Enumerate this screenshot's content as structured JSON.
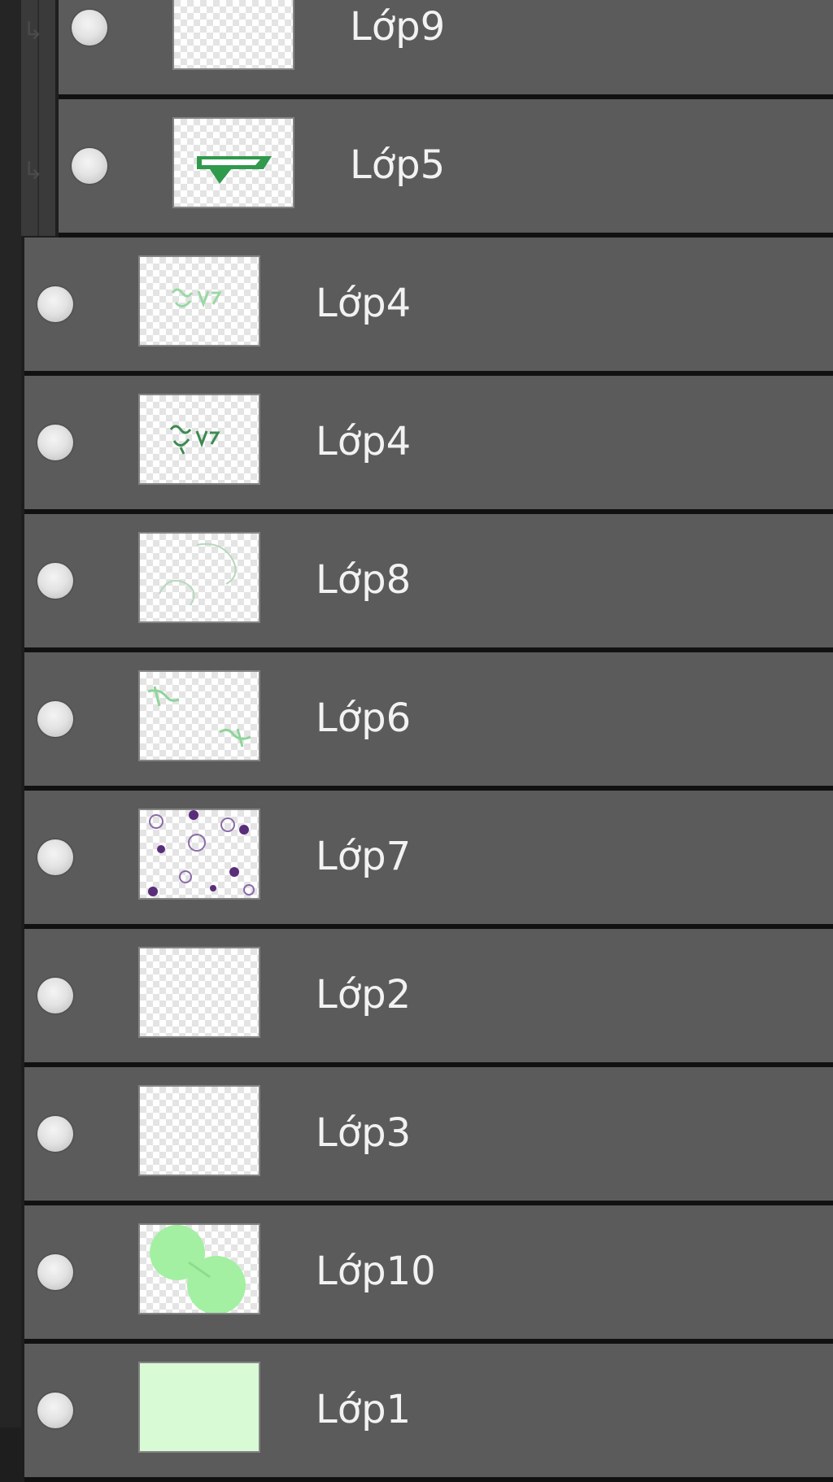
{
  "layers_panel": {
    "clipped_group": [
      {
        "name": "Lớp9",
        "visibility_icon": "eye-dot-icon",
        "thumbnail": "transparent"
      },
      {
        "name": "Lớp5",
        "visibility_icon": "eye-dot-icon",
        "thumbnail": "green-shape"
      }
    ],
    "layers": [
      {
        "name": "Lớp4",
        "visibility_icon": "eye-dot-icon",
        "thumbnail": "light-green-text"
      },
      {
        "name": "Lớp4",
        "visibility_icon": "eye-dot-icon",
        "thumbnail": "green-text"
      },
      {
        "name": "Lớp8",
        "visibility_icon": "eye-dot-icon",
        "thumbnail": "faint-green-lines"
      },
      {
        "name": "Lớp6",
        "visibility_icon": "eye-dot-icon",
        "thumbnail": "green-corner-vines"
      },
      {
        "name": "Lớp7",
        "visibility_icon": "eye-dot-icon",
        "thumbnail": "purple-dots"
      },
      {
        "name": "Lớp2",
        "visibility_icon": "eye-dot-icon",
        "thumbnail": "transparent"
      },
      {
        "name": "Lớp3",
        "visibility_icon": "eye-dot-icon",
        "thumbnail": "transparent"
      },
      {
        "name": "Lớp10",
        "visibility_icon": "eye-dot-icon",
        "thumbnail": "green-circles"
      },
      {
        "name": "Lớp1",
        "visibility_icon": "eye-dot-icon",
        "thumbnail": "solid-light-green"
      }
    ]
  },
  "colors": {
    "row_background": "#5b5b5b",
    "row_separator": "#111111",
    "panel_background": "#1e1e1e",
    "text": "#f2f2f2",
    "accent_green": "#3aa055",
    "light_green": "#a8f0a8",
    "purple": "#5a2d7a"
  }
}
